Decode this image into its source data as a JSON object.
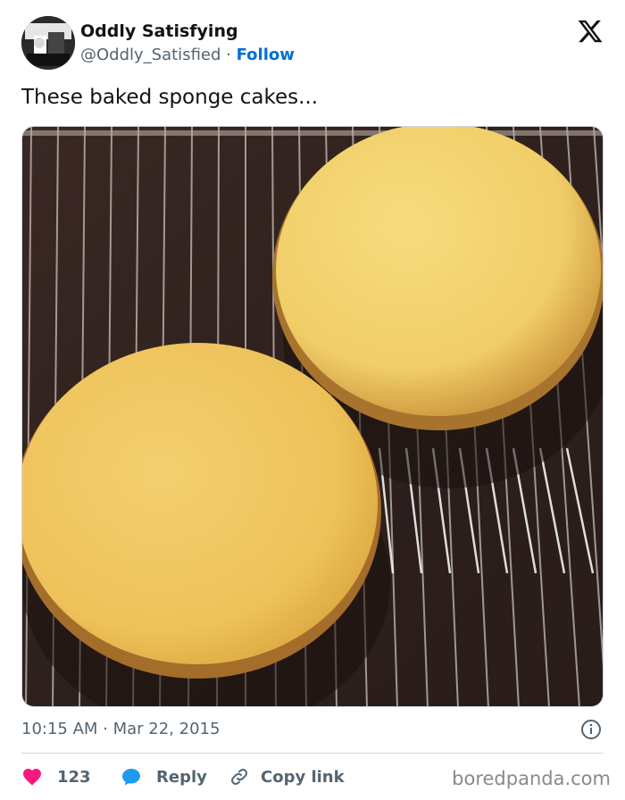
{
  "account": {
    "name": "Oddly Satisfying",
    "handle": "@Oddly_Satisfied",
    "separator": "·",
    "follow_label": "Follow"
  },
  "tweet": {
    "text": "These baked sponge cakes...",
    "timestamp": "10:15 AM · Mar 22, 2015",
    "image_alt": "Two round baked sponge cakes cooling on a wire rack"
  },
  "actions": {
    "likes": "123",
    "reply_label": "Reply",
    "copy_link_label": "Copy link"
  },
  "watermark": "boredpanda.com",
  "icons": {
    "brand": "x-logo-icon",
    "info": "info-icon",
    "like": "heart-icon",
    "reply": "speech-bubble-icon",
    "copy": "link-icon"
  },
  "colors": {
    "follow": "#006fd6",
    "heart": "#f91880",
    "reply": "#1d9bf0",
    "muted": "#536471"
  }
}
